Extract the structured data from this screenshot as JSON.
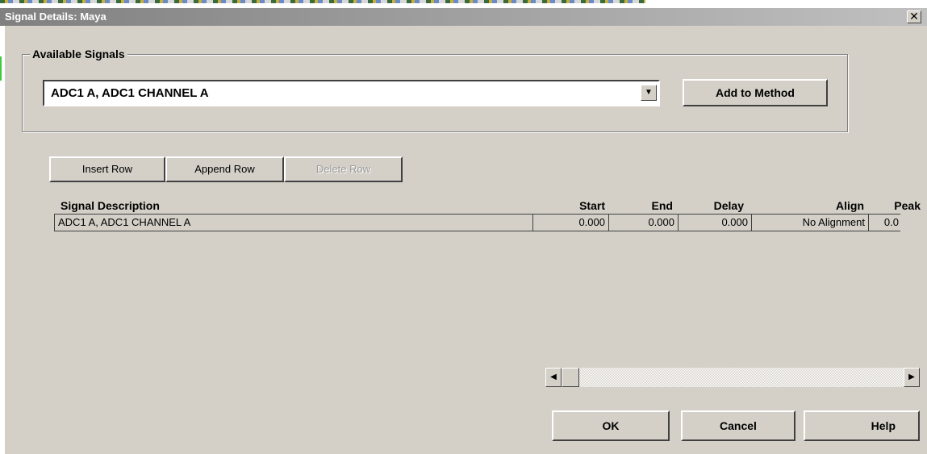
{
  "window": {
    "title": "Signal Details: Maya",
    "close_glyph": "✕"
  },
  "available_signals": {
    "group_label": "Available Signals",
    "selected_signal": "ADC1 A, ADC1 CHANNEL A",
    "add_button": "Add to Method"
  },
  "row_buttons": {
    "insert": "Insert Row",
    "append": "Append Row",
    "delete": "Delete Row"
  },
  "table": {
    "columns": {
      "description": "Signal Description",
      "start": "Start",
      "end": "End",
      "delay": "Delay",
      "align": "Align",
      "peak": "Peak"
    },
    "rows": [
      {
        "description": "ADC1 A, ADC1 CHANNEL A",
        "start": "0.000",
        "end": "0.000",
        "delay": "0.000",
        "align": "No Alignment",
        "peak": "0.0"
      }
    ]
  },
  "scrollbar": {
    "left_arrow": "◀",
    "right_arrow": "▶"
  },
  "dialog_buttons": {
    "ok": "OK",
    "cancel": "Cancel",
    "help": "Help"
  },
  "colors": {
    "face": "#d4d0c8",
    "title_gradient_start": "#808080",
    "title_gradient_end": "#c0c0c0"
  }
}
